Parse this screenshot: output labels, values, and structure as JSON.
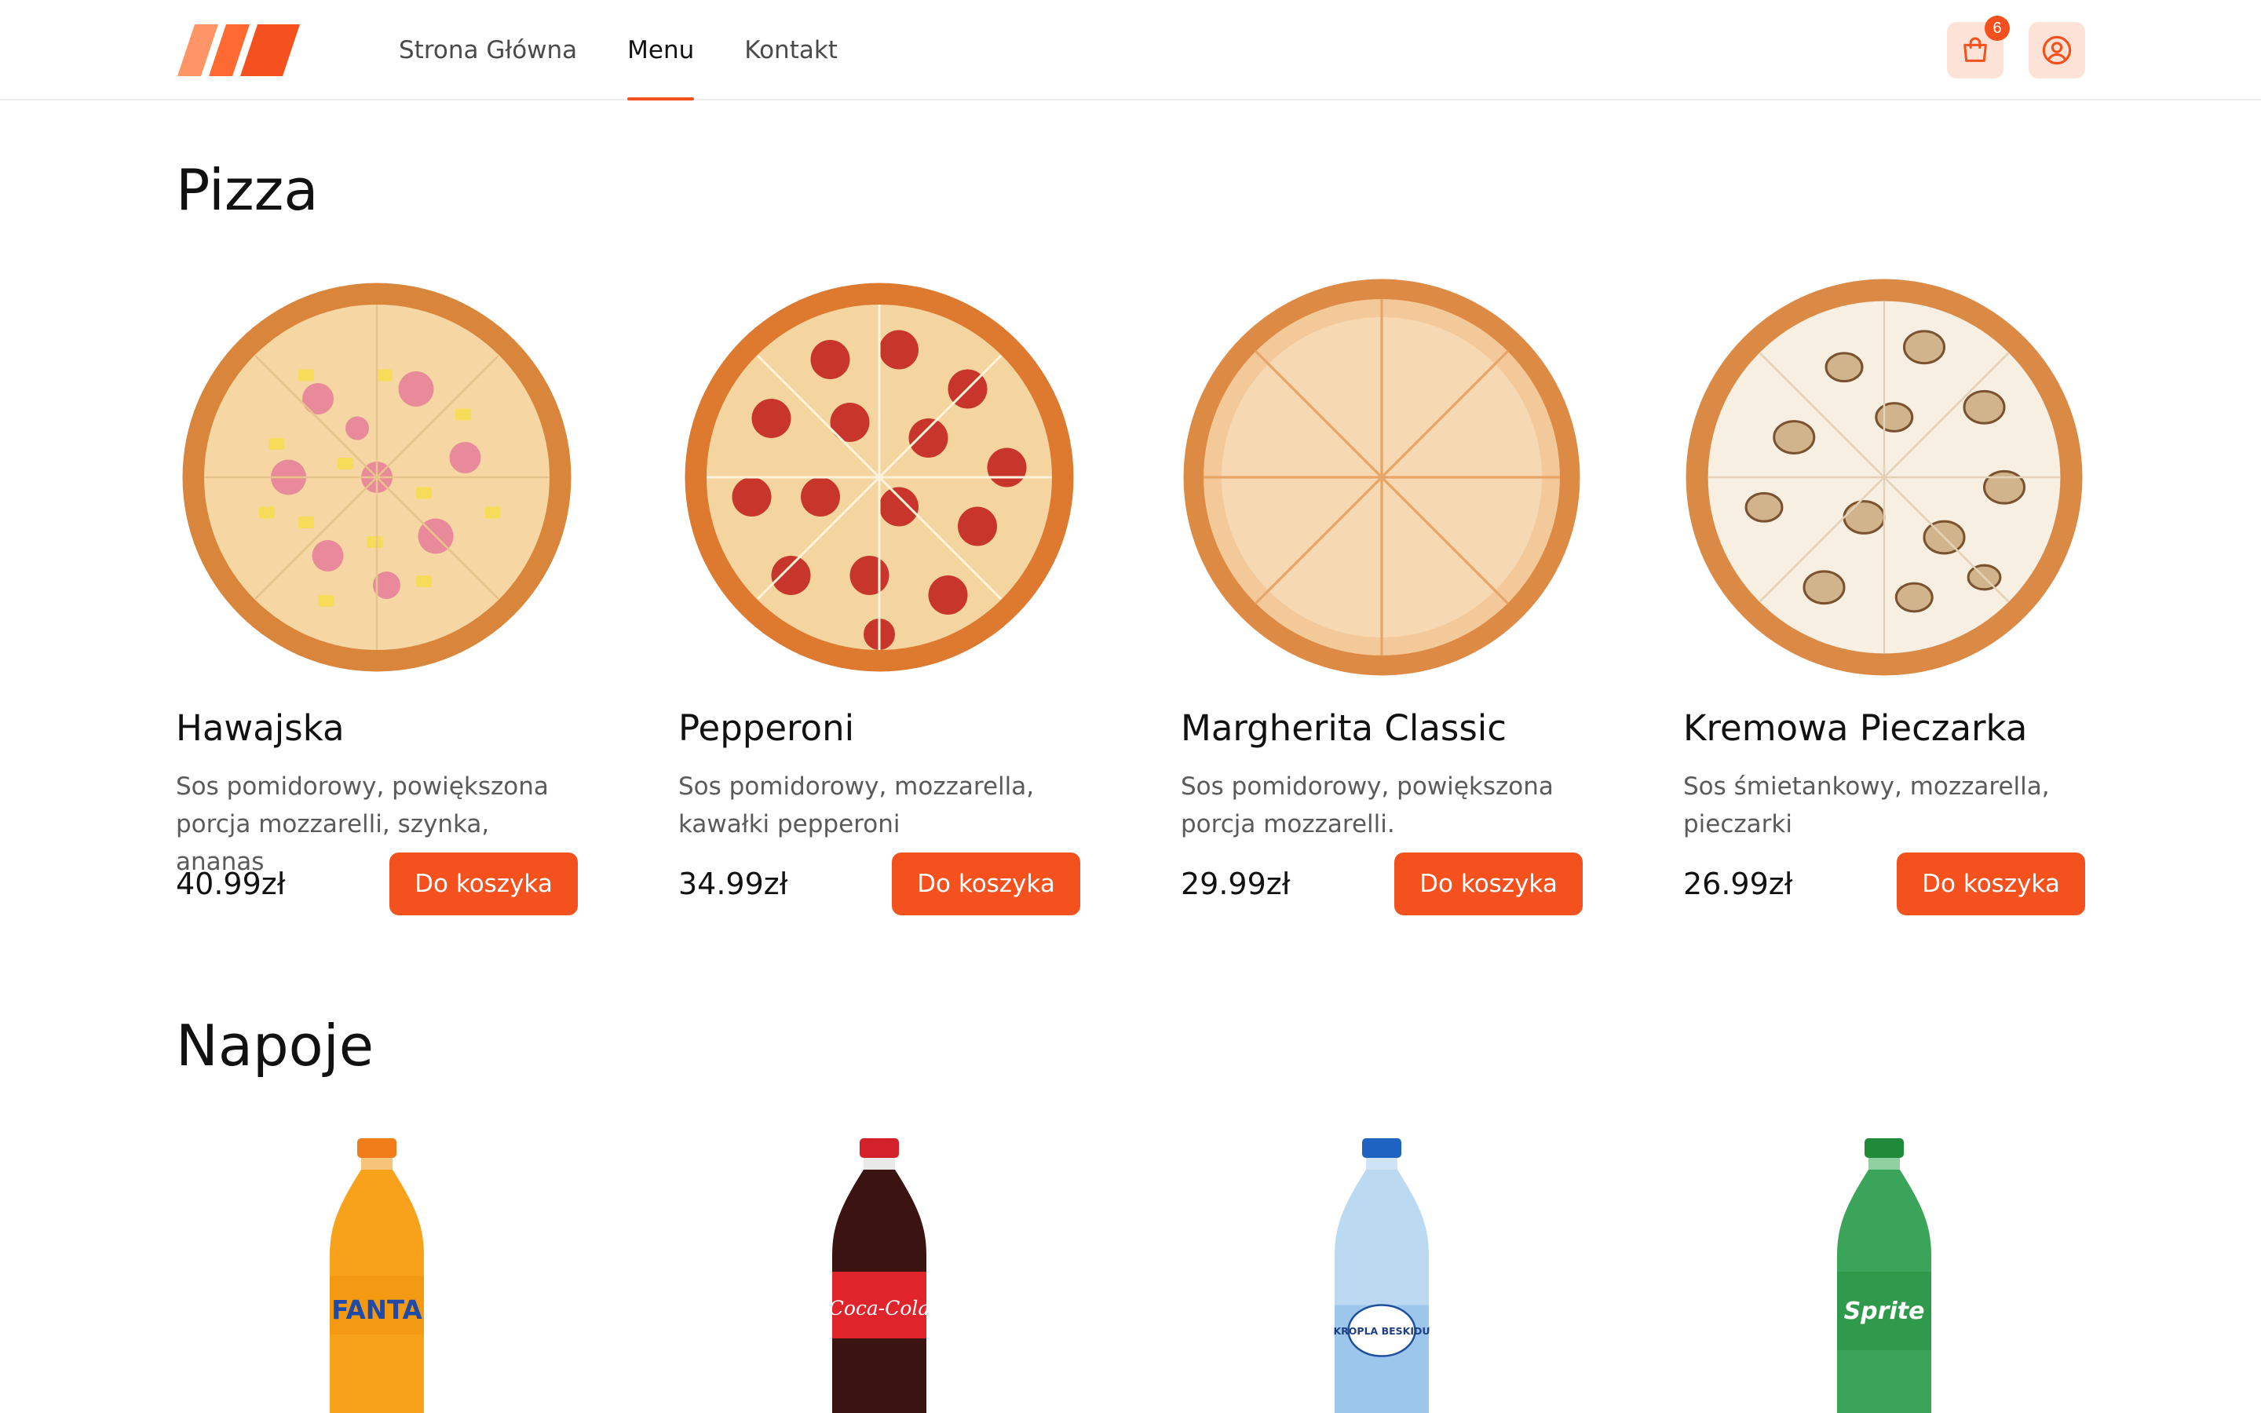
{
  "header": {
    "nav": [
      {
        "label": "Strona Główna",
        "active": false
      },
      {
        "label": "Menu",
        "active": true
      },
      {
        "label": "Kontakt",
        "active": false
      }
    ],
    "cart_count": "6",
    "accent_color": "#f4511e",
    "icons": [
      "logo-stripes",
      "shopping-bag-icon",
      "user-icon"
    ]
  },
  "pizza_section": {
    "title": "Pizza",
    "items": [
      {
        "name": "Hawajska",
        "description": "Sos pomidorowy, powiększona porcja mozzarelli, szynka, ananas",
        "price": "40.99zł",
        "button": "Do koszyka"
      },
      {
        "name": "Pepperoni",
        "description": "Sos pomidorowy, mozzarella, kawałki pepperoni",
        "price": "34.99zł",
        "button": "Do koszyka"
      },
      {
        "name": "Margherita Classic",
        "description": "Sos pomidorowy, powiększona porcja mozzarelli.",
        "price": "29.99zł",
        "button": "Do koszyka"
      },
      {
        "name": "Kremowa Pieczarka",
        "description": "Sos śmietankowy, mozzarella, pieczarki",
        "price": "26.99zł",
        "button": "Do koszyka"
      }
    ]
  },
  "drinks_section": {
    "title": "Napoje",
    "items": [
      {
        "label": "FANTA"
      },
      {
        "label": "Coca-Cola"
      },
      {
        "label": "KROPLA BESKIDU"
      },
      {
        "label": "Sprite"
      }
    ]
  }
}
